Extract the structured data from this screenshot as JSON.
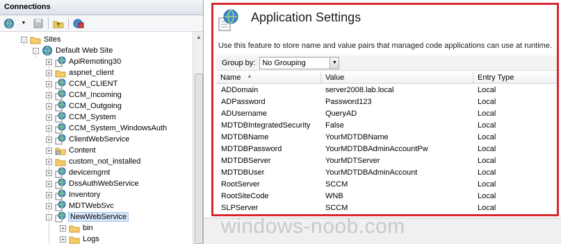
{
  "connections": {
    "title": "Connections",
    "tree": [
      {
        "label": "Sites",
        "icon": "folder-icon",
        "level": 1,
        "expander": "-"
      },
      {
        "label": "Default Web Site",
        "icon": "globe-icon",
        "level": 2,
        "expander": "-"
      },
      {
        "label": "ApiRemoting30",
        "icon": "web-application-icon",
        "level": 3,
        "expander": "+"
      },
      {
        "label": "aspnet_client",
        "icon": "folder-icon",
        "level": 3,
        "expander": "+"
      },
      {
        "label": "CCM_CLIENT",
        "icon": "web-application-icon",
        "level": 3,
        "expander": "+"
      },
      {
        "label": "CCM_Incoming",
        "icon": "web-application-icon",
        "level": 3,
        "expander": "+"
      },
      {
        "label": "CCM_Outgoing",
        "icon": "web-application-icon",
        "level": 3,
        "expander": "+"
      },
      {
        "label": "CCM_System",
        "icon": "web-application-icon",
        "level": 3,
        "expander": "+"
      },
      {
        "label": "CCM_System_WindowsAuth",
        "icon": "web-application-icon",
        "level": 3,
        "expander": "+"
      },
      {
        "label": "ClientWebService",
        "icon": "web-application-icon",
        "level": 3,
        "expander": "+"
      },
      {
        "label": "Content",
        "icon": "shortcut-folder-icon",
        "level": 3,
        "expander": "+"
      },
      {
        "label": "custom_not_installed",
        "icon": "folder-icon",
        "level": 3,
        "expander": "+"
      },
      {
        "label": "devicemgmt",
        "icon": "web-application-icon",
        "level": 3,
        "expander": "+"
      },
      {
        "label": "DssAuthWebService",
        "icon": "web-application-icon",
        "level": 3,
        "expander": "+"
      },
      {
        "label": "Inventory",
        "icon": "web-application-icon",
        "level": 3,
        "expander": "+"
      },
      {
        "label": "MDTWebSvc",
        "icon": "web-application-icon",
        "level": 3,
        "expander": "+"
      },
      {
        "label": "NewWebService",
        "icon": "web-application-icon",
        "level": 3,
        "expander": "-",
        "selected": true
      },
      {
        "label": "bin",
        "icon": "folder-icon",
        "level": 4,
        "expander": "+"
      },
      {
        "label": "Logs",
        "icon": "folder-icon",
        "level": 4,
        "expander": "+"
      }
    ]
  },
  "feature": {
    "title": "Application Settings",
    "description": "Use this feature to store name and value pairs that managed code applications can use at runtime.",
    "group_by_label": "Group by:",
    "group_by_value": "No Grouping"
  },
  "grid": {
    "columns": [
      "Name",
      "Value",
      "Entry Type"
    ],
    "rows": [
      [
        "ADDomain",
        "server2008.lab.local",
        "Local"
      ],
      [
        "ADPassword",
        "Password123",
        "Local"
      ],
      [
        "ADUsername",
        "QueryAD",
        "Local"
      ],
      [
        "MDTDBIntegratedSecurity",
        "False",
        "Local"
      ],
      [
        "MDTDBName",
        "YourMDTDBName",
        "Local"
      ],
      [
        "MDTDBPassword",
        "YourMDTDBAdminAccountPw",
        "Local"
      ],
      [
        "MDTDBServer",
        "YourMDTServer",
        "Local"
      ],
      [
        "MDTDBUser",
        "YourMDTDBAdminAccount",
        "Local"
      ],
      [
        "RootServer",
        "SCCM",
        "Local"
      ],
      [
        "RootSiteCode",
        "WNB",
        "Local"
      ],
      [
        "SLPServer",
        "SCCM",
        "Local"
      ]
    ]
  },
  "watermark": "windows-noob.com",
  "colors": {
    "highlight": "#d6262e",
    "selection": "#d6e6f7"
  }
}
